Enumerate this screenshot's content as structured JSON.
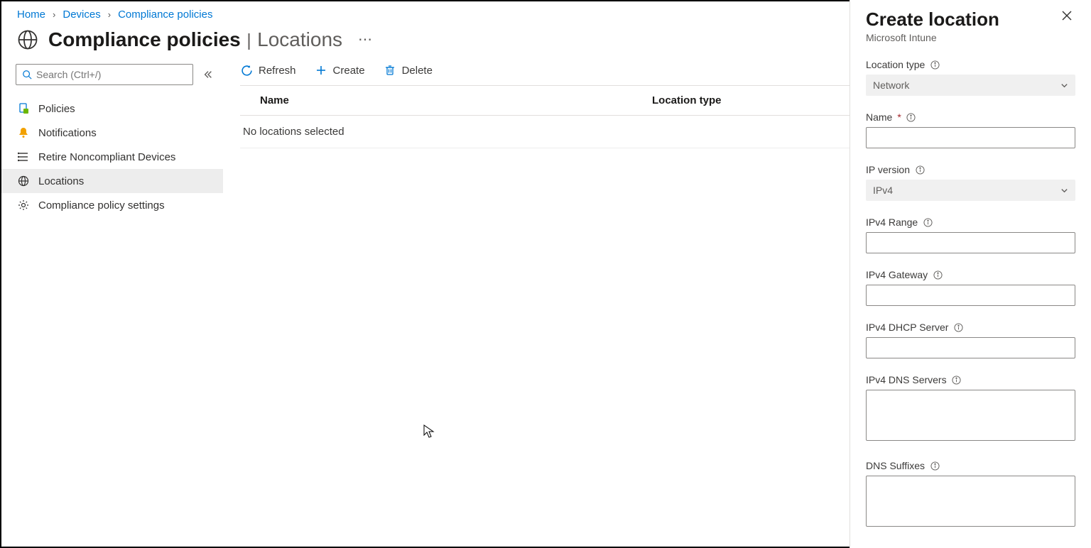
{
  "breadcrumb": {
    "home": "Home",
    "devices": "Devices",
    "compliance": "Compliance policies"
  },
  "header": {
    "title": "Compliance policies",
    "subtitle": "Locations"
  },
  "search": {
    "placeholder": "Search (Ctrl+/)"
  },
  "sidebar": {
    "items": [
      {
        "label": "Policies"
      },
      {
        "label": "Notifications"
      },
      {
        "label": "Retire Noncompliant Devices"
      },
      {
        "label": "Locations"
      },
      {
        "label": "Compliance policy settings"
      }
    ]
  },
  "toolbar": {
    "refresh": "Refresh",
    "create": "Create",
    "delete": "Delete"
  },
  "table": {
    "columns": {
      "name": "Name",
      "type": "Location type"
    },
    "empty": "No locations selected"
  },
  "panel": {
    "title": "Create location",
    "subtitle": "Microsoft Intune",
    "fields": {
      "location_type_label": "Location type",
      "location_type_value": "Network",
      "name_label": "Name",
      "ip_version_label": "IP version",
      "ip_version_value": "IPv4",
      "ipv4_range_label": "IPv4 Range",
      "ipv4_gateway_label": "IPv4 Gateway",
      "ipv4_dhcp_label": "IPv4 DHCP Server",
      "ipv4_dns_label": "IPv4 DNS Servers",
      "dns_suffixes_label": "DNS Suffixes"
    }
  }
}
